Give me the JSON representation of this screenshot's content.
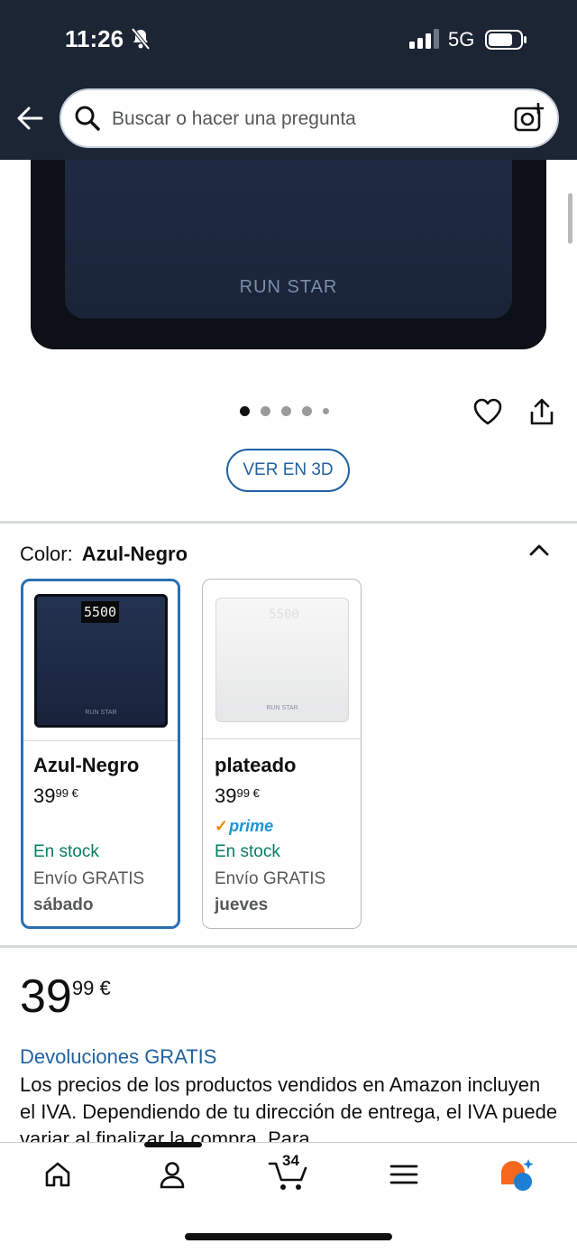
{
  "status_bar": {
    "time": "11:26",
    "network": "5G"
  },
  "search": {
    "placeholder": "Buscar o hacer una pregunta"
  },
  "product_image": {
    "brand": "RUN STAR"
  },
  "carousel": {
    "count": 5,
    "active": 0
  },
  "view_3d_label": "VER EN 3D",
  "color": {
    "label": "Color:",
    "selected": "Azul-Negro"
  },
  "variants": [
    {
      "name": "Azul-Negro",
      "price_whole": "39",
      "price_fraction": "99",
      "currency": "€",
      "display": "5500",
      "brand": "RUN STAR",
      "prime": "",
      "stock": "En stock",
      "shipping": "Envío GRATIS",
      "delivery_day": "sábado"
    },
    {
      "name": "plateado",
      "price_whole": "39",
      "price_fraction": "99",
      "currency": "€",
      "display": "5500",
      "brand": "RUN STAR",
      "prime": "prime",
      "stock": "En stock",
      "shipping": "Envío GRATIS",
      "delivery_day": "jueves"
    }
  ],
  "price": {
    "whole": "39",
    "fraction": "99",
    "currency": "€"
  },
  "returns_link": "Devoluciones GRATIS",
  "vat_text": "Los precios de los productos vendidos en Amazon incluyen el IVA. Dependiendo de tu dirección de entrega, el IVA puede variar al finalizar la compra. Para",
  "bottom_nav": {
    "cart_count": "34",
    "items": [
      "home-icon",
      "account-icon",
      "cart-icon",
      "menu-icon",
      "assistant-icon"
    ]
  },
  "colors": {
    "header": "#1b2533",
    "link": "#2162a1",
    "stock": "#067d62",
    "selected_border": "#2a70b0"
  }
}
